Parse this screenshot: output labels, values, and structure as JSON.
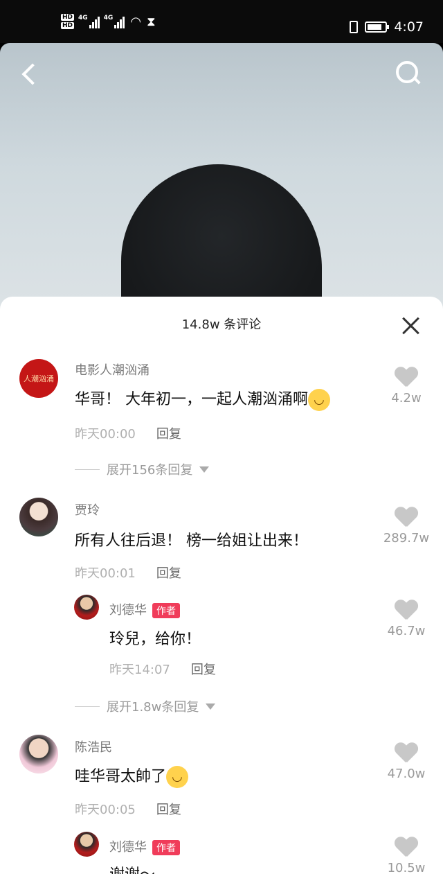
{
  "status_bar": {
    "hd1": "HD",
    "hd2": "HD",
    "net1": "4G",
    "net2": "4G",
    "time": "4:07"
  },
  "video": {
    "back_icon": "chevron-left-icon",
    "search_icon": "search-icon"
  },
  "panel": {
    "title": "14.8w 条评论",
    "close_icon": "close-icon"
  },
  "comments": [
    {
      "avatar_text": "人潮汹涌",
      "user": "电影人潮汹涌",
      "text": "华哥！ 大年初一，一起人潮汹涌啊",
      "emoji": "grin-emoji",
      "time": "昨天00:00",
      "reply": "回复",
      "likes": "4.2w",
      "expand": "展开156条回复"
    },
    {
      "user": "贾玲",
      "text": "所有人往后退！ 榜一给姐让出来！",
      "time": "昨天00:01",
      "reply": "回复",
      "likes": "289.7w",
      "sub": {
        "user": "刘德华",
        "tag": "作者",
        "text": "玲兒，给你！",
        "time": "昨天14:07",
        "reply": "回复",
        "likes": "46.7w"
      },
      "expand": "展开1.8w条回复"
    },
    {
      "user": "陈浩民",
      "text": "哇华哥太帥了",
      "emoji": "wink-emoji",
      "time": "昨天00:05",
      "reply": "回复",
      "likes": "47.0w",
      "sub": {
        "user": "刘德华",
        "tag": "作者",
        "text": "谢谢～",
        "likes": "10.5w"
      }
    }
  ]
}
